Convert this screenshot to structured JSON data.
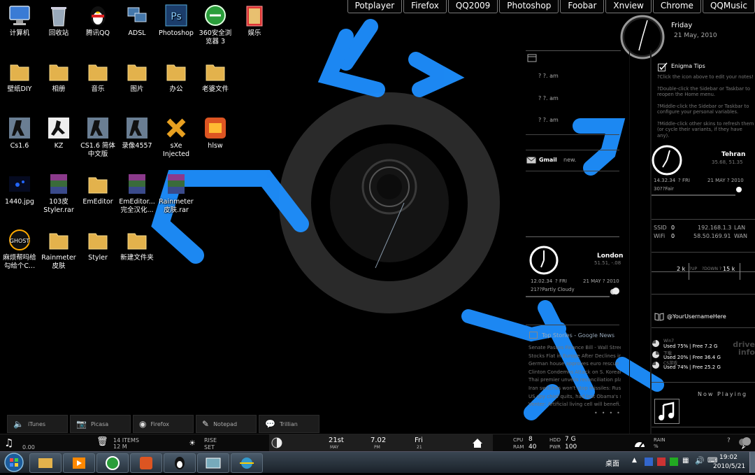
{
  "launcher": [
    "Potplayer",
    "Firefox",
    "QQ2009",
    "Photoshop",
    "Foobar",
    "Xnview",
    "Chrome",
    "QQMusic"
  ],
  "desktop_icons": [
    [
      "计算机",
      "回收站",
      "腾讯QQ",
      "ADSL",
      "Photoshop",
      "360安全浏览器 3",
      "娱乐"
    ],
    [
      "壁纸DIY",
      "相册",
      "音乐",
      "图片",
      "办公",
      "老婆文件"
    ],
    [
      "Cs1.6",
      "KZ",
      "CS1.6 简体中文版",
      "录像4557",
      "sXe Injected",
      "hlsw"
    ],
    [
      "1440.jpg",
      "103皮Styler.rar",
      "EmEditor",
      "EmEditor...完全汉化...",
      "Rainmeter皮肤.rar"
    ],
    [
      "麻烦帮吗给勾给个C...",
      "Rainmeter皮肤",
      "Styler",
      "新建文件夹"
    ]
  ],
  "clock": {
    "day": "Friday",
    "date": "21 May, 2010"
  },
  "calendar": {
    "entries": [
      "? ?. am",
      "? ?. am",
      "? ?. am"
    ]
  },
  "gmail": {
    "label": "Gmail",
    "status": "new."
  },
  "london": {
    "city": "London",
    "coords": "51.51, -.08",
    "time": "12.02.34",
    "day": "? FRI",
    "date": "21 MAY ? 2010",
    "weather": "21??Partly Cloudy"
  },
  "news": {
    "title": "Top Stories - Google News",
    "items": [
      "Senate Passes Finance Bill - Wall Stree...",
      "Stocks Flat in Europe After Declines in...",
      "German house approves euro rescue - ...",
      "Clinton Condemns Attack on S. Korean...",
      "Thai premier unveils reconciliation pla...",
      "Iran switches won't stop missiles: Russ...",
      "US spy chief quits, had lost Obama's su...",
      "Venter: Artificial living cell will benefi..."
    ]
  },
  "tips": {
    "title": "Enigma Tips",
    "lines": [
      "?Click the icon above to edit your notes!",
      "?Double-click the Sidebar or Taskbar to reopen the Home menu.",
      "?Middle-click the Sidebar or Taskbar to configure your personal variables.",
      "?Middle-click other skins to refresh them (or cycle their variants, if they have any)."
    ]
  },
  "tehran": {
    "city": "Tehran",
    "coords": "35.68, 51.35",
    "time": "14.32.34",
    "day": "? FRI",
    "date": "21 MAY ? 2010",
    "weather": "30??Fair"
  },
  "network": {
    "ssid_label": "SSID",
    "ssid_val": "0",
    "ssid_ip": "192.168.1.3",
    "ssid_type": "LAN",
    "wifi_label": "WiFi",
    "wifi_val": "0",
    "wifi_ip": "58.50.169.91",
    "wifi_type": "WAN"
  },
  "traffic": {
    "up": "2 k",
    "up_label": "?UP",
    "down_label": "?DOWN ?",
    "down": "15 k"
  },
  "twitter": {
    "user": "@YourUsernameHere"
  },
  "drives": {
    "logo": "drive info",
    "items": [
      {
        "name": "Win7",
        "used": "Used 75%",
        "free": "| Free 7.2 G"
      },
      {
        "name": "下载",
        "used": "Used 20%",
        "free": "| Free 36.4 G"
      },
      {
        "name": "CS游戏",
        "used": "Used 74%",
        "free": "| Free 25.2 G"
      }
    ]
  },
  "now_playing": {
    "label": "Now Playing"
  },
  "dock": [
    "iTunes",
    "Picasa",
    "Firefox",
    "Notepad",
    "Trillian"
  ],
  "infobar": {
    "time_left": "0.00",
    "items_count": "14 ITEMS",
    "items_size": "12 M",
    "rise": "RISE",
    "set": "SET",
    "day_num": "21st",
    "month": "MAY",
    "clock_time": "7.02",
    "ampm": "PM",
    "weekday": "Fri",
    "weekday_num": "21",
    "cpu": "CPU",
    "cpu_val": "8",
    "ram": "RAM",
    "ram_val": "40",
    "hdd": "HDD",
    "hdd_val": "7 G",
    "pwr": "PWR",
    "pwr_val": "100",
    "rain": "RAIN",
    "rain_val": "%",
    "weather_val": "?"
  },
  "taskbar": {
    "desktop_label": "桌面",
    "time": "19:02",
    "date": "2010/5/21"
  }
}
